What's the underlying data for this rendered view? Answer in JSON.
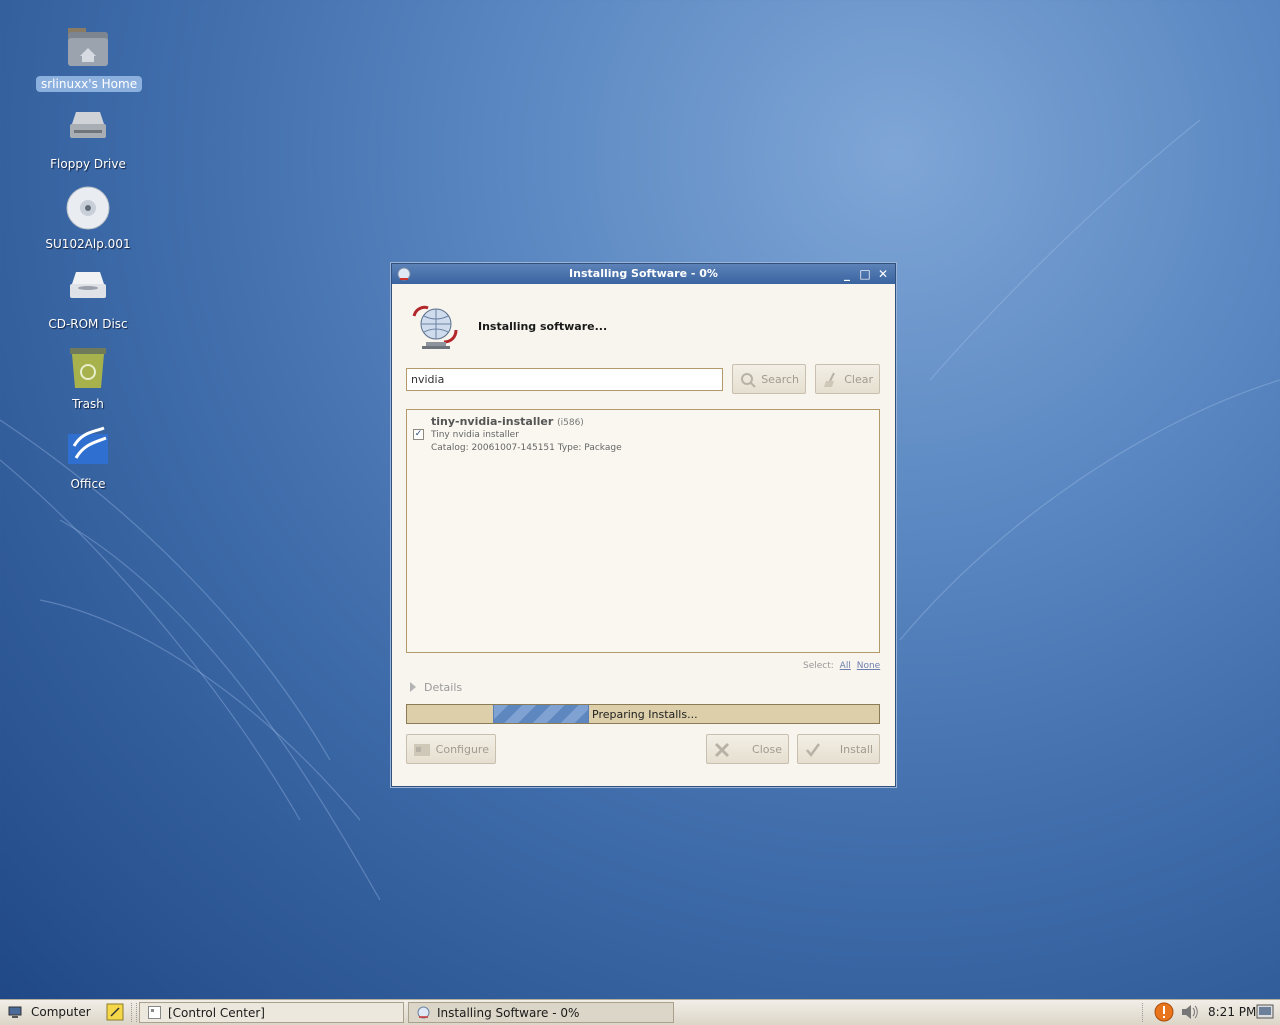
{
  "desktop": {
    "icons": [
      {
        "label": "srlinuxx's Home",
        "icon": "home-folder-icon"
      },
      {
        "label": "Floppy Drive",
        "icon": "floppy-drive-icon"
      },
      {
        "label": "SU102Alp.001",
        "icon": "cd-disc-icon"
      },
      {
        "label": "CD-ROM Disc",
        "icon": "cdrom-drive-icon"
      },
      {
        "label": "Trash",
        "icon": "trash-icon"
      },
      {
        "label": "Office",
        "icon": "office-icon"
      }
    ]
  },
  "window": {
    "title": "Installing Software - 0%",
    "heading": "Installing software...",
    "search": {
      "value": "nvidia",
      "button": "Search",
      "clear_button": "Clear"
    },
    "packages": [
      {
        "name": "tiny-nvidia-installer",
        "arch": "(i586)",
        "description": "Tiny nvidia installer",
        "catalog": "Catalog: 20061007-145151 Type: Package",
        "checked": true
      }
    ],
    "select": {
      "label": "Select:",
      "all": "All",
      "none": "None"
    },
    "details_label": "Details",
    "progress": {
      "text": "Preparing Installs...",
      "mode": "indeterminate"
    },
    "buttons": {
      "configure": "Configure",
      "close": "Close",
      "install": "Install"
    }
  },
  "taskbar": {
    "menu_label": "Computer",
    "tasks": [
      {
        "label": "[Control Center]"
      },
      {
        "label": "Installing Software - 0%"
      }
    ],
    "clock": "8:21 PM"
  },
  "colors": {
    "titlebar": "#3a64a0",
    "window_bg": "#f8f5ee",
    "progress_fill": "#6f95c9"
  }
}
